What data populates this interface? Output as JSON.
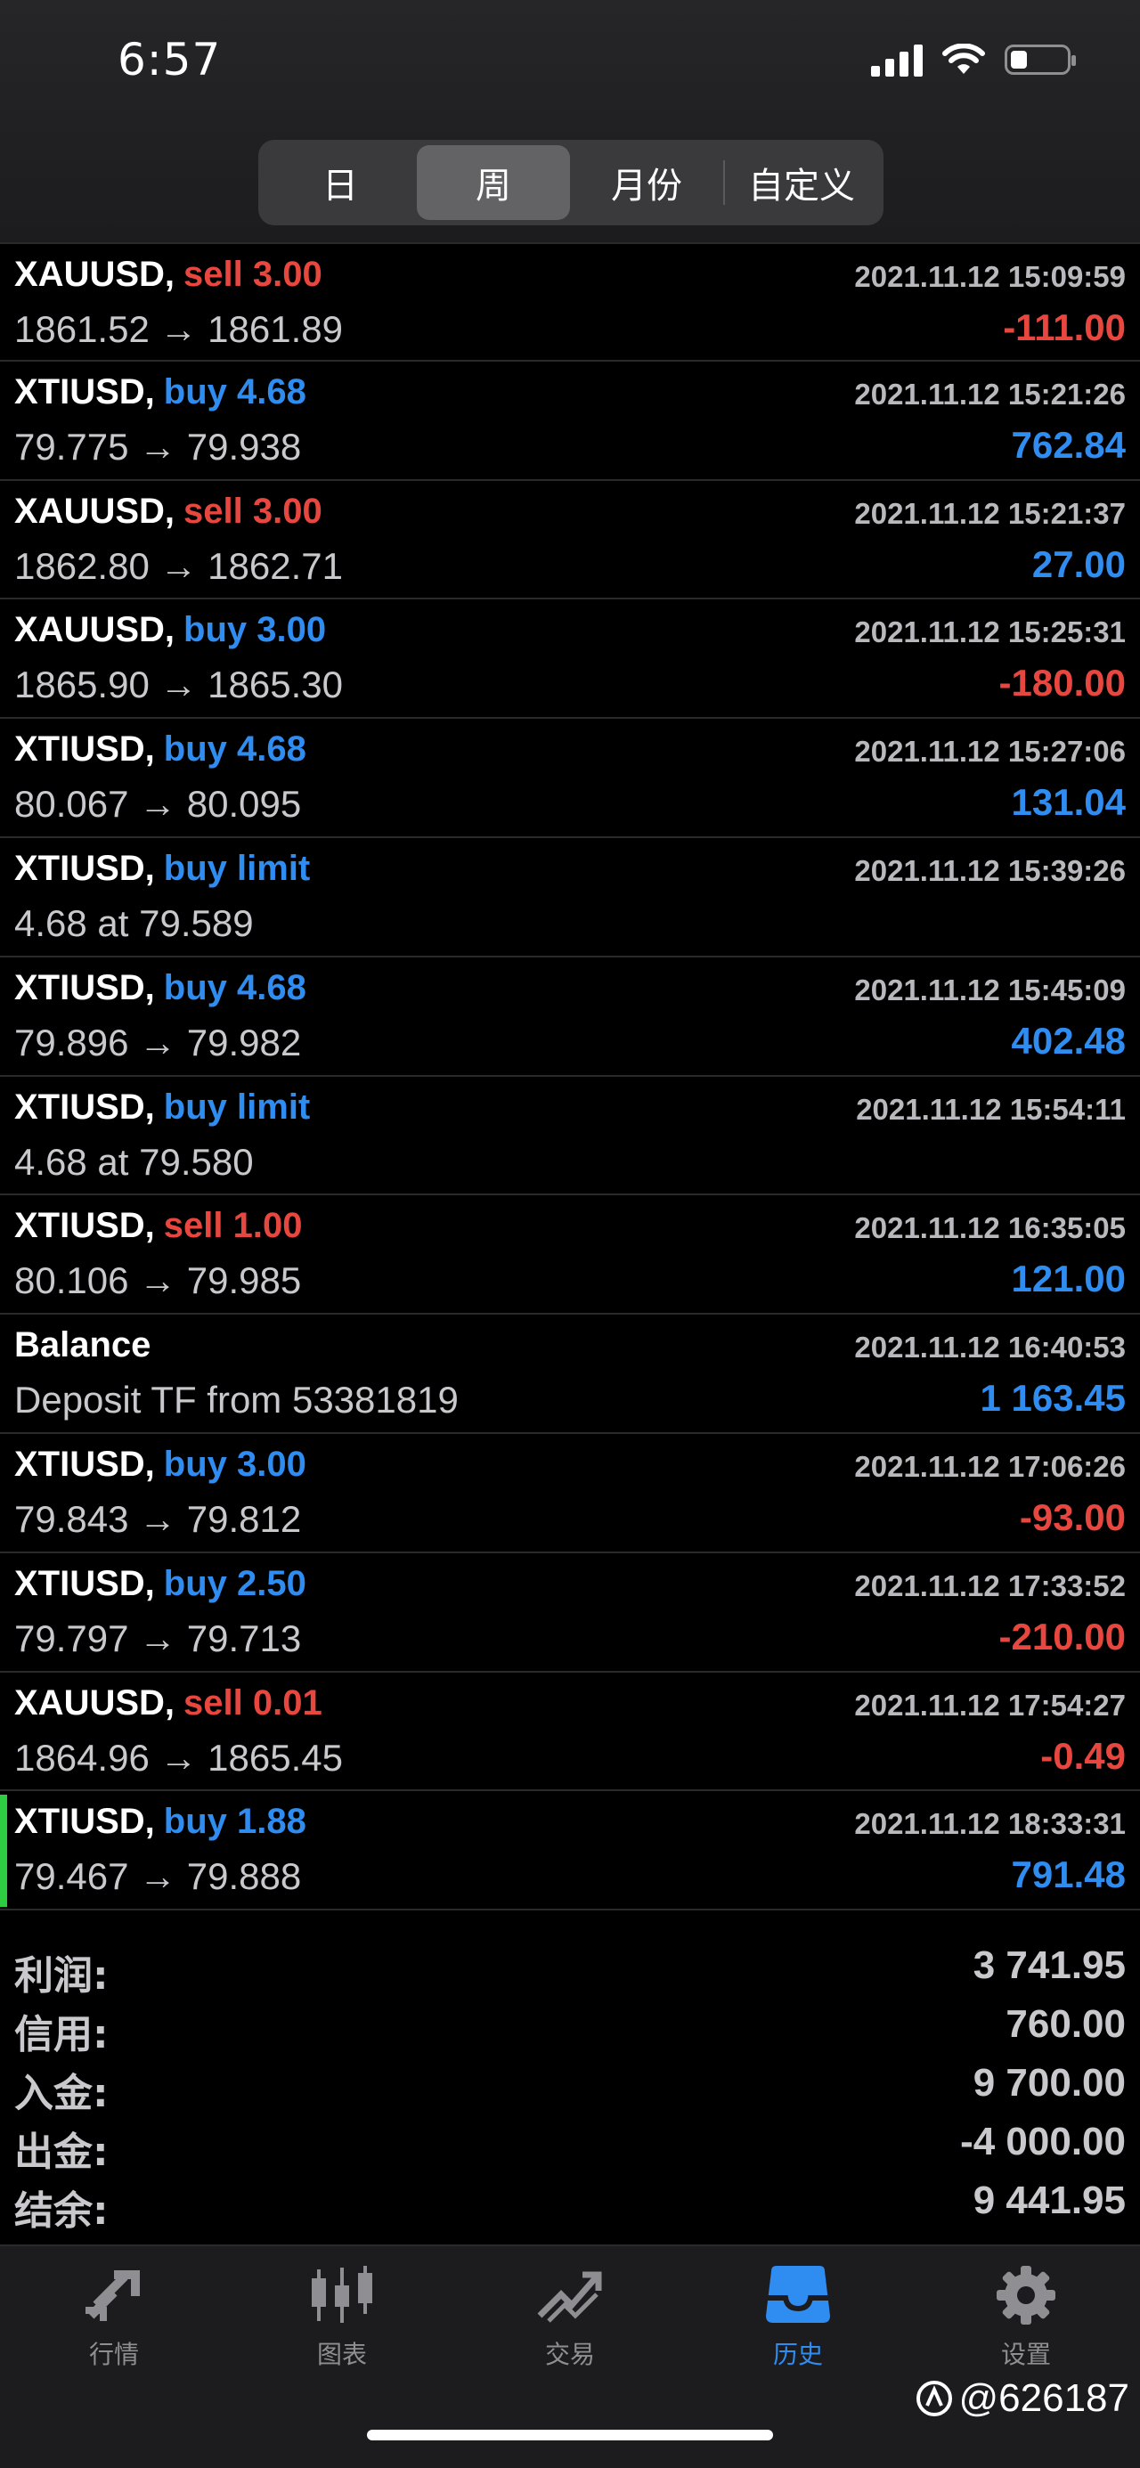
{
  "status_bar": {
    "time": "6:57"
  },
  "segments": [
    {
      "label": "日",
      "active": false
    },
    {
      "label": "周",
      "active": true
    },
    {
      "label": "月份",
      "active": false
    },
    {
      "label": "自定义",
      "active": false
    }
  ],
  "deals": [
    {
      "symbol": "XAUUSD,",
      "side": "sell 3.00",
      "side_color": "red",
      "datetime": "2021.11.12 15:09:59",
      "prices": "1861.52 → 1861.89",
      "profit": "-111.00",
      "profit_color": "red"
    },
    {
      "symbol": "XTIUSD,",
      "side": "buy 4.68",
      "side_color": "blue",
      "datetime": "2021.11.12 15:21:26",
      "prices": "79.775 → 79.938",
      "profit": "762.84",
      "profit_color": "blue"
    },
    {
      "symbol": "XAUUSD,",
      "side": "sell 3.00",
      "side_color": "red",
      "datetime": "2021.11.12 15:21:37",
      "prices": "1862.80 → 1862.71",
      "profit": "27.00",
      "profit_color": "blue"
    },
    {
      "symbol": "XAUUSD,",
      "side": "buy 3.00",
      "side_color": "blue",
      "datetime": "2021.11.12 15:25:31",
      "prices": "1865.90 → 1865.30",
      "profit": "-180.00",
      "profit_color": "red"
    },
    {
      "symbol": "XTIUSD,",
      "side": "buy 4.68",
      "side_color": "blue",
      "datetime": "2021.11.12 15:27:06",
      "prices": "80.067 → 80.095",
      "profit": "131.04",
      "profit_color": "blue"
    },
    {
      "symbol": "XTIUSD,",
      "side": "buy limit",
      "side_color": "blue",
      "datetime": "2021.11.12 15:39:26",
      "prices": "4.68 at 79.589",
      "profit": "",
      "profit_color": "blue"
    },
    {
      "symbol": "XTIUSD,",
      "side": "buy 4.68",
      "side_color": "blue",
      "datetime": "2021.11.12 15:45:09",
      "prices": "79.896 → 79.982",
      "profit": "402.48",
      "profit_color": "blue"
    },
    {
      "symbol": "XTIUSD,",
      "side": "buy limit",
      "side_color": "blue",
      "datetime": "2021.11.12 15:54:11",
      "prices": "4.68 at 79.580",
      "profit": "",
      "profit_color": "blue"
    },
    {
      "symbol": "XTIUSD,",
      "side": "sell 1.00",
      "side_color": "red",
      "datetime": "2021.11.12 16:35:05",
      "prices": "80.106 → 79.985",
      "profit": "121.00",
      "profit_color": "blue"
    },
    {
      "symbol": "Balance",
      "side": "",
      "side_color": "white",
      "datetime": "2021.11.12 16:40:53",
      "prices": "Deposit TF from 53381819",
      "profit": "1 163.45",
      "profit_color": "blue"
    },
    {
      "symbol": "XTIUSD,",
      "side": "buy 3.00",
      "side_color": "blue",
      "datetime": "2021.11.12 17:06:26",
      "prices": "79.843 → 79.812",
      "profit": "-93.00",
      "profit_color": "red"
    },
    {
      "symbol": "XTIUSD,",
      "side": "buy 2.50",
      "side_color": "blue",
      "datetime": "2021.11.12 17:33:52",
      "prices": "79.797 → 79.713",
      "profit": "-210.00",
      "profit_color": "red"
    },
    {
      "symbol": "XAUUSD,",
      "side": "sell 0.01",
      "side_color": "red",
      "datetime": "2021.11.12 17:54:27",
      "prices": "1864.96 → 1865.45",
      "profit": "-0.49",
      "profit_color": "red"
    },
    {
      "symbol": "XTIUSD,",
      "side": "buy 1.88",
      "side_color": "blue",
      "datetime": "2021.11.12 18:33:31",
      "prices": "79.467 → 79.888",
      "profit": "791.48",
      "profit_color": "blue",
      "selected": true
    }
  ],
  "summary": [
    {
      "label": "利润:",
      "value": "3 741.95"
    },
    {
      "label": "信用:",
      "value": "760.00"
    },
    {
      "label": "入金:",
      "value": "9 700.00"
    },
    {
      "label": "出金:",
      "value": "-4 000.00"
    },
    {
      "label": "结余:",
      "value": "9 441.95"
    }
  ],
  "tabs": [
    {
      "label": "行情",
      "icon": "quotes-arrows-icon",
      "active": false
    },
    {
      "label": "图表",
      "icon": "candlestick-chart-icon",
      "active": false
    },
    {
      "label": "交易",
      "icon": "trade-trend-icon",
      "active": false
    },
    {
      "label": "历史",
      "icon": "history-tray-icon",
      "active": true
    },
    {
      "label": "设置",
      "icon": "gear-icon",
      "active": false
    }
  ],
  "watermark": "@626187",
  "colors": {
    "red": "#e8473f",
    "blue": "#2f8cf0",
    "active_tab": "#2f8cf0",
    "selected_marker": "#2ecc40"
  }
}
